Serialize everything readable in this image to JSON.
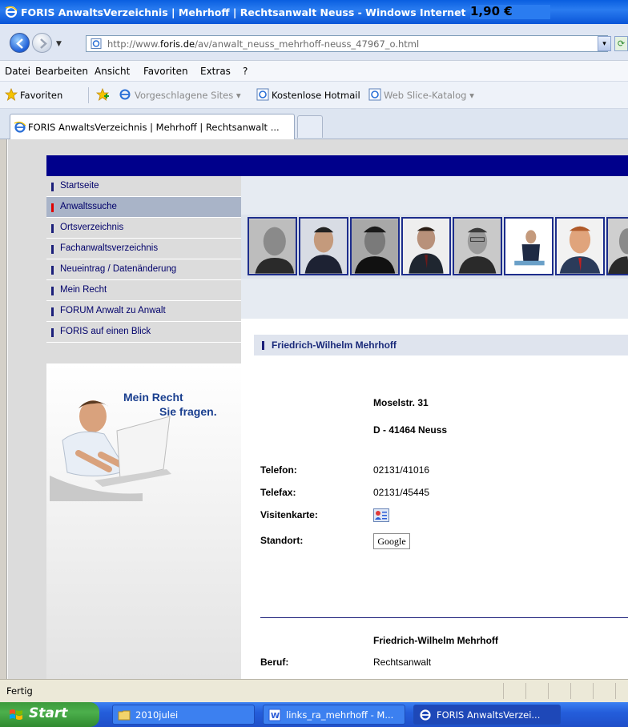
{
  "window": {
    "title": "FORIS AnwaltsVerzeichnis | Mehrhoff | Rechtsanwalt Neuss - Windows Internet Explorer",
    "title_overlay": "1,90 €"
  },
  "address": {
    "url_prefix": "http://www.",
    "url_domain": "foris.de",
    "url_rest": "/av/anwalt_neuss_mehrhoff-neuss_47967_o.html"
  },
  "menu": [
    "Datei",
    "Bearbeiten",
    "Ansicht",
    "Favoriten",
    "Extras",
    "?"
  ],
  "favorites": {
    "label": "Favoriten",
    "items": [
      "Vorgeschlagene Sites ▾",
      "Kostenlose Hotmail",
      "Web Slice-Katalog ▾"
    ]
  },
  "tab": {
    "label": "FORIS AnwaltsVerzeichnis | Mehrhoff | Rechtsanwalt ..."
  },
  "nav": [
    "Startseite",
    "Anwaltssuche",
    "Ortsverzeichnis",
    "Fachanwaltsverzeichnis",
    "Neueintrag / Datenänderung",
    "Mein Recht",
    "FORUM Anwalt zu Anwalt",
    "FORIS auf einen Blick"
  ],
  "promo": {
    "line1": "Mein Recht",
    "line2": "Sie fragen."
  },
  "profile": {
    "name": "Friedrich-Wilhelm Mehrhoff",
    "street": "Moselstr. 31",
    "city": "D - 41464 Neuss",
    "labels": {
      "phone": "Telefon:",
      "fax": "Telefax:",
      "vcard": "Visitenkarte:",
      "location": "Standort:",
      "job": "Beruf:"
    },
    "phone": "02131/41016",
    "fax": "02131/45445",
    "google": "Google",
    "name_repeat": "Friedrich-Wilhelm Mehrhoff",
    "job": "Rechtsanwalt"
  },
  "status": {
    "text": "Fertig"
  },
  "taskbar": {
    "start": "Start",
    "tasks": [
      "2010julei",
      "links_ra_mehrhoff - M...",
      "FORIS AnwaltsVerzei..."
    ]
  }
}
